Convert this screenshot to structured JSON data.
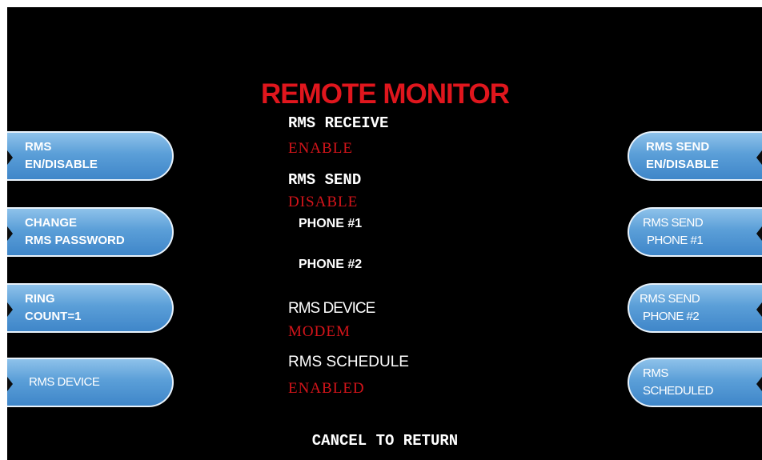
{
  "screen": {
    "title": "REMOTE MONITOR",
    "footer": "CANCEL TO RETURN"
  },
  "left_buttons": [
    {
      "line1": "RMS",
      "line2": "EN/DISABLE"
    },
    {
      "line1": "CHANGE",
      "line2": "RMS PASSWORD"
    },
    {
      "line1": "RING",
      "line2": "COUNT=1"
    },
    {
      "line1": "RMS DEVICE",
      "line2": ""
    }
  ],
  "right_buttons": [
    {
      "line1": "RMS SEND",
      "line2": "EN/DISABLE"
    },
    {
      "line1": "RMS SEND",
      "line2": "PHONE #1"
    },
    {
      "line1": "RMS SEND",
      "line2": "PHONE #2"
    },
    {
      "line1": "RMS",
      "line2": "SCHEDULED"
    }
  ],
  "status": {
    "rms_receive_label": "RMS RECEIVE",
    "rms_receive_value": "ENABLE",
    "rms_send_label": "RMS SEND",
    "rms_send_value": "DISABLE",
    "phone1_label": "PHONE #1",
    "phone2_label": "PHONE #2",
    "rms_device_label": "RMS DEVICE",
    "rms_device_value": "MODEM",
    "rms_schedule_label": "RMS SCHEDULE",
    "rms_schedule_value": "ENABLED"
  },
  "colors": {
    "background": "#000000",
    "title": "#e0161d",
    "value": "#d4141a",
    "button": "#5b9fd8"
  }
}
